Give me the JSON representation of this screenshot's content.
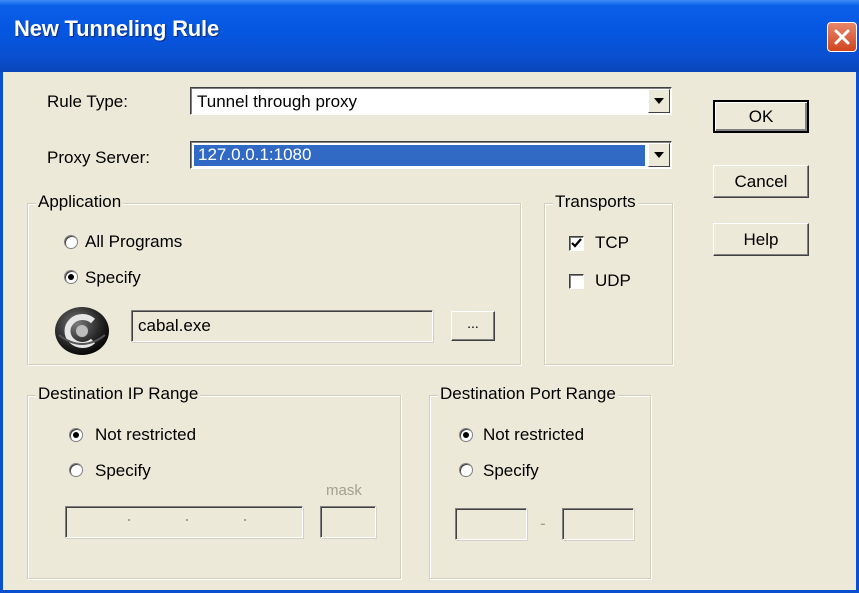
{
  "window": {
    "title": "New Tunneling Rule"
  },
  "rule_type": {
    "label": "Rule Type:",
    "value": "Tunnel through proxy"
  },
  "proxy_server": {
    "label": "Proxy Server:",
    "value": "127.0.0.1:1080"
  },
  "buttons": {
    "ok": "OK",
    "cancel": "Cancel",
    "help": "Help"
  },
  "application": {
    "title": "Application",
    "all_programs": "All Programs",
    "specify": "Specify",
    "selected": "specify",
    "path": "cabal.exe",
    "browse": "..."
  },
  "transports": {
    "title": "Transports",
    "tcp": "TCP",
    "tcp_checked": true,
    "udp": "UDP",
    "udp_checked": false
  },
  "dest_ip": {
    "title": "Destination IP Range",
    "not_restricted": "Not restricted",
    "specify": "Specify",
    "mask_label": "mask",
    "selected": "not_restricted"
  },
  "dest_port": {
    "title": "Destination Port Range",
    "not_restricted": "Not restricted",
    "specify": "Specify",
    "separator": "-",
    "selected": "not_restricted"
  },
  "icons": {
    "close": "close-icon",
    "dropdown": "chevron-down-icon",
    "app": "cabal-app-icon"
  },
  "colors": {
    "titlebar": "#0a4fd0",
    "selection": "#316ac5",
    "face": "#ece9d8",
    "disabled_text": "#a1a192"
  }
}
